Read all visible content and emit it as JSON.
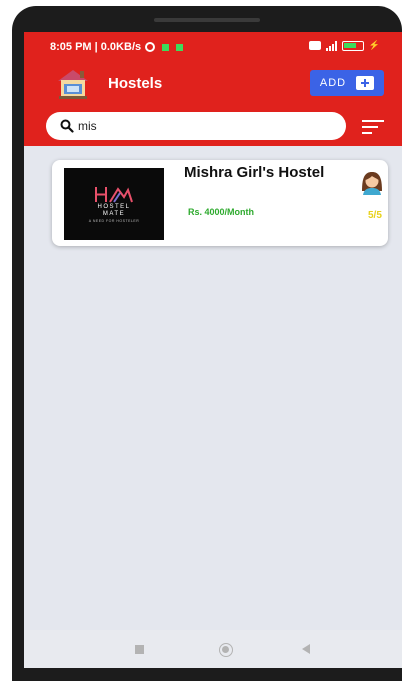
{
  "status_bar": {
    "time_speed": "8:05 PM | 0.0KB/s",
    "icons": [
      "alarm-icon",
      "notification-icon",
      "notification-icon",
      "badge-icon",
      "signal-icon",
      "battery-icon",
      "charging-icon"
    ]
  },
  "header": {
    "title": "Hostels",
    "add_label": "ADD",
    "logo_icon": "hostel-building-icon"
  },
  "search": {
    "value": "mis",
    "placeholder": ""
  },
  "filter_icon": "sort-filter-icon",
  "hostels": [
    {
      "name": "Mishra Girl's Hostel",
      "price": "Rs. 4000/Month",
      "rating": "5/5",
      "thumbnail": {
        "brand_line1": "HOSTEL",
        "brand_line2": "MATE",
        "tagline": "A NEED FOR HOSTELER"
      },
      "gender_icon": "female-avatar-icon"
    }
  ],
  "colors": {
    "appbar": "#e0221d",
    "add_button": "#3b63e6",
    "price": "#2eaa2e",
    "rating": "#e8d21a",
    "background": "#e4e7ee"
  },
  "nav_bar": [
    "recents-square-icon",
    "home-circle-icon",
    "back-triangle-icon"
  ]
}
